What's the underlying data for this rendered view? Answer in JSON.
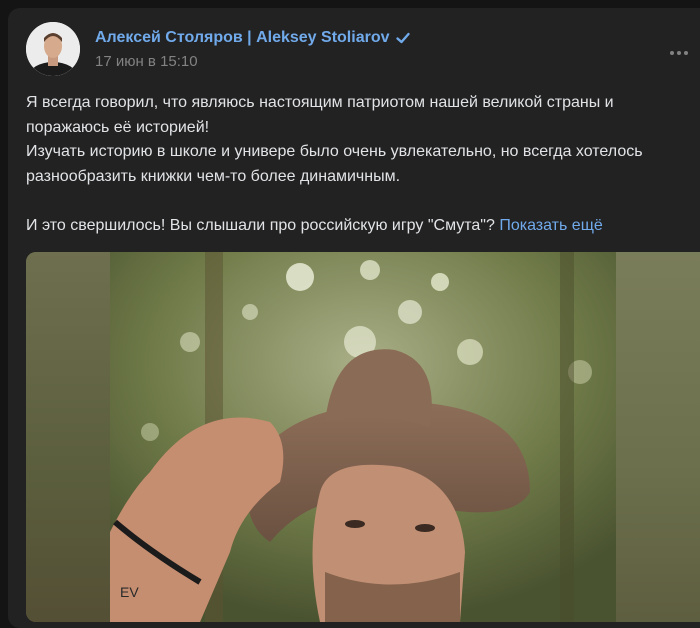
{
  "post": {
    "author": "Алексей Столяров | Aleksey Stoliarov",
    "date": "17 июн в 15:10",
    "lines": [
      "Я всегда говорил, что являюсь настоящим патриотом нашей великой страны и",
      "поражаюсь её историей!",
      "Изучать историю в школе и универе было очень увлекательно, но всегда хотелось",
      "разнообразить книжки чем-то более динамичным."
    ],
    "last_line": "И это свершилось! Вы слышали про российскую игру \"Смута\"?",
    "show_more": "Показать ещё"
  },
  "icons": {
    "verified": "verified-check-icon",
    "more": "more-dots-icon"
  },
  "colors": {
    "link": "#71aaeb",
    "card_bg": "#222222",
    "page_bg": "#141414",
    "muted": "#828282"
  }
}
